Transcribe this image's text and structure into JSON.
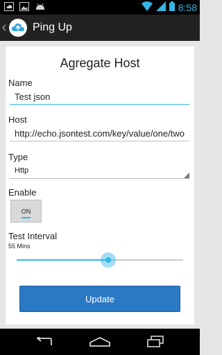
{
  "status_bar": {
    "time": "8:58",
    "left_icons": [
      "notification-cloud-icon",
      "image-icon",
      "android-icon"
    ],
    "right_icons": [
      "wifi-icon",
      "signal-icon",
      "battery-icon"
    ],
    "accent": "#33b5e5"
  },
  "action_bar": {
    "title": "Ping Up",
    "icon": "cloud-upload-icon",
    "background": "#222222"
  },
  "form": {
    "title": "Agregate Host",
    "name_label": "Name",
    "name_value": "Test json",
    "host_label": "Host",
    "host_value": "http://echo.jsontest.com/key/value/one/two",
    "type_label": "Type",
    "type_value": "Http",
    "enable_label": "Enable",
    "enable_state": "ON",
    "interval_label": "Test Interval",
    "interval_value": "55 Mins",
    "interval_fraction": 0.55,
    "update_label": "Update"
  },
  "nav_bar": {
    "buttons": [
      "back-icon",
      "home-icon",
      "recent-apps-icon"
    ]
  },
  "colors": {
    "accent": "#33b5e5",
    "button": "#2a79c4",
    "card": "#ffffff",
    "background": "#e6e6e6"
  }
}
